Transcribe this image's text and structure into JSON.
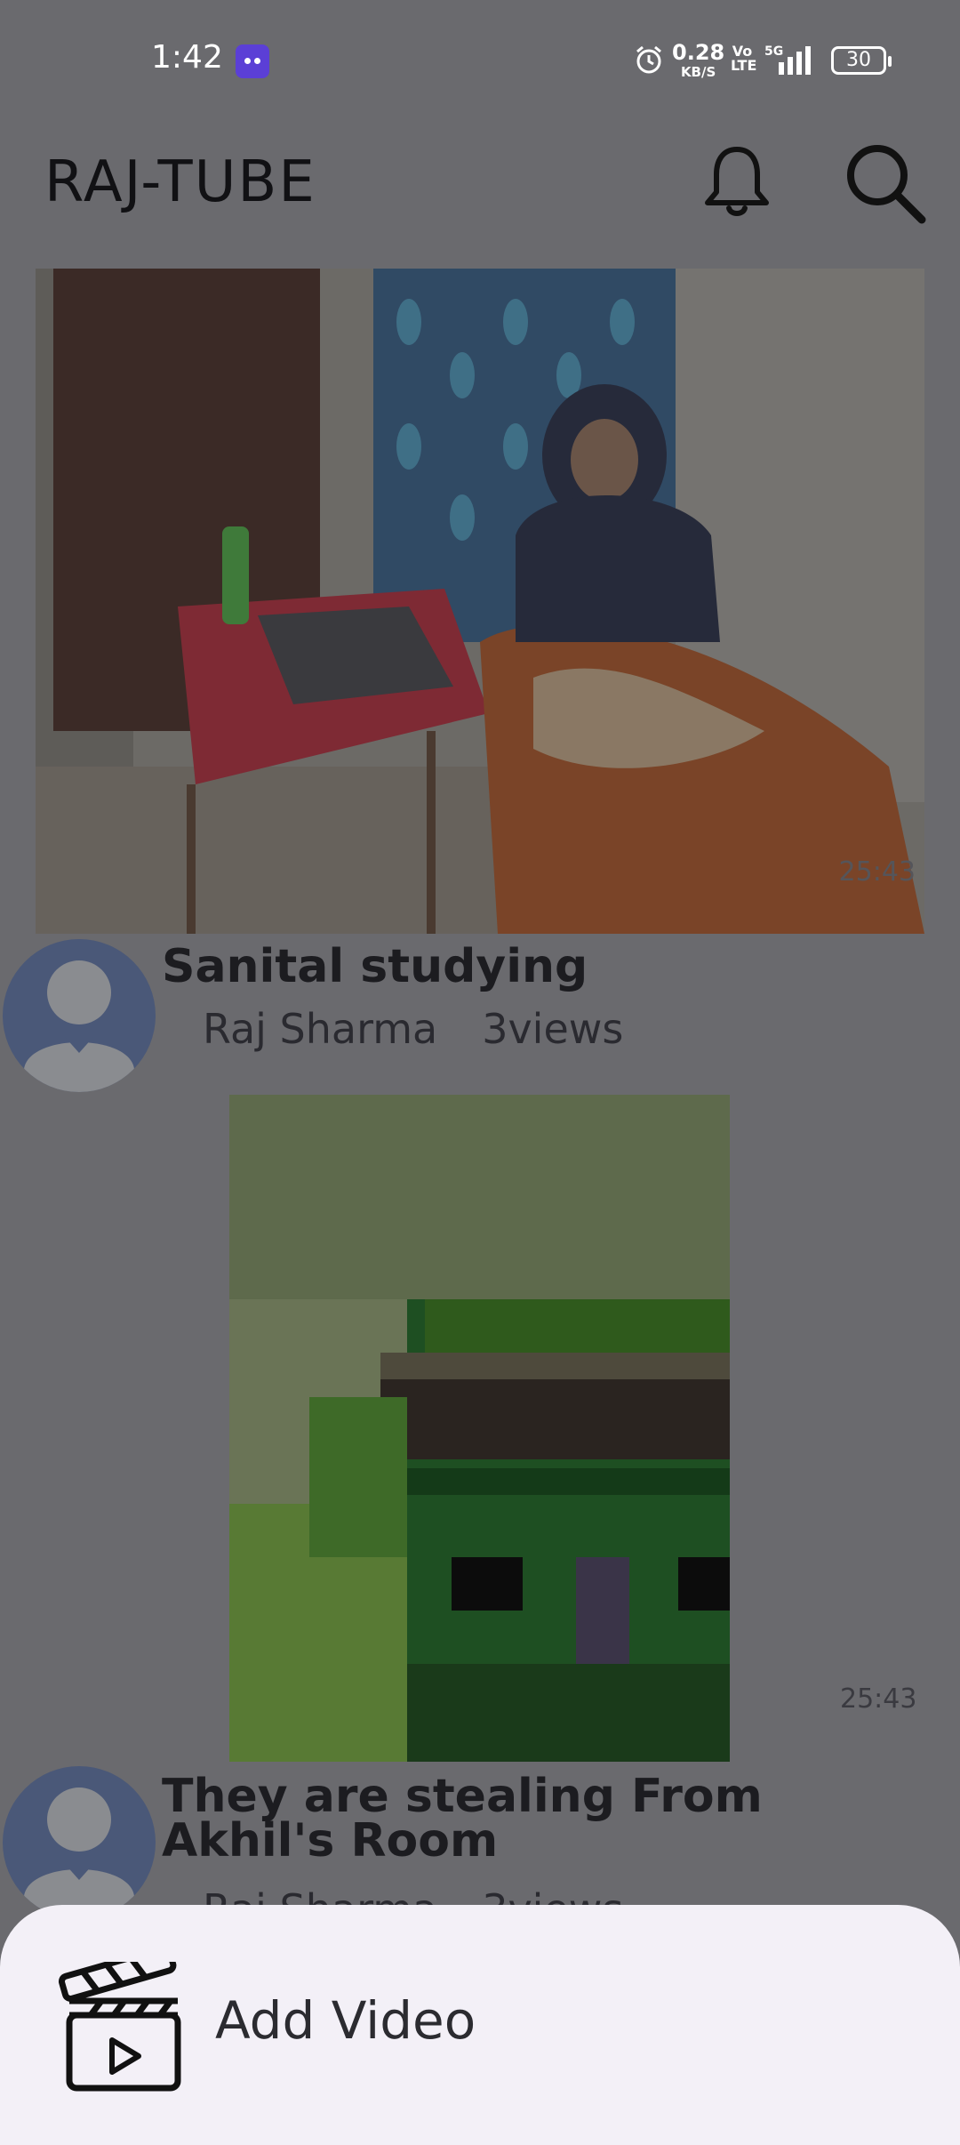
{
  "status_bar": {
    "time": "1:42",
    "data_speed": "0.28",
    "data_unit": "KB/S",
    "volte": "Vo LTE",
    "network": "5G",
    "battery": "30"
  },
  "app_bar": {
    "title": "RAJ-TUBE",
    "icons": [
      "bell-icon",
      "search-icon"
    ]
  },
  "videos": [
    {
      "title": "Sanital studying",
      "channel": "Raj Sharma",
      "views": "3views",
      "duration": "25:43"
    },
    {
      "title": "They are stealing From Akhil's Room",
      "channel": "Raj Sharma",
      "views": "3views",
      "duration": "25:43"
    }
  ],
  "bottom_sheet": {
    "add_video_label": "Add Video",
    "icon": "clapperboard-icon"
  },
  "colors": {
    "scrim": "#6a6a6e",
    "sheet_background": "#f3f0f7",
    "avatar_background": "#4a5878"
  }
}
